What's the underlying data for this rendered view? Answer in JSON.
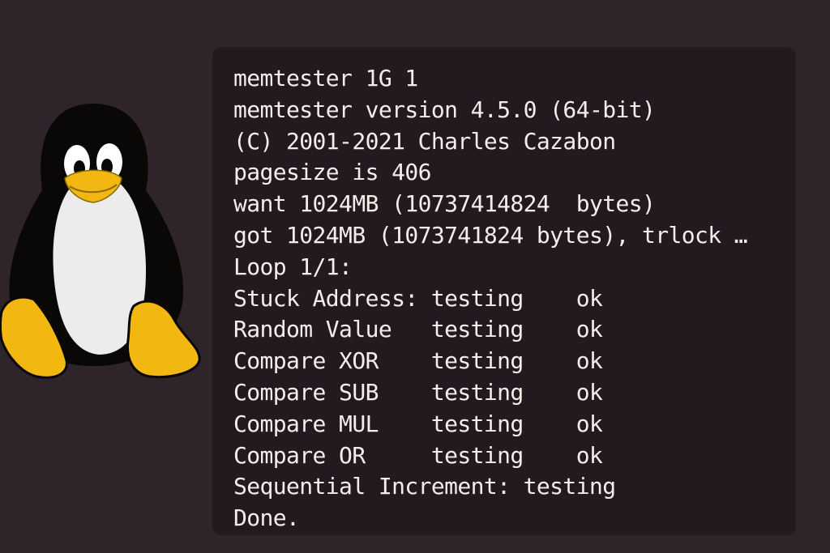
{
  "terminal": {
    "lines": [
      "memtester 1G 1",
      "memtester version 4.5.0 (64-bit)",
      "(C) 2001-2021 Charles Cazabon",
      "pagesize is 406",
      "want 1024MB (10737414824  bytes)",
      "got 1024MB (1073741824 bytes), trlock …",
      "Loop 1/1:",
      "Stuck Address: testing    ok",
      "Random Value   testing    ok",
      "Compare XOR    testing    ok",
      "Compare SUB    testing    ok",
      "Compare MUL    testing    ok",
      "Compare OR     testing    ok",
      "Sequential Increment: testing",
      "Done."
    ]
  },
  "mascot": {
    "icon": "tux-penguin-icon"
  },
  "colors": {
    "background": "#2e2429",
    "terminal_background": "#221a1f",
    "text": "#f2eee9",
    "penguin_yellow": "#f2b711"
  }
}
